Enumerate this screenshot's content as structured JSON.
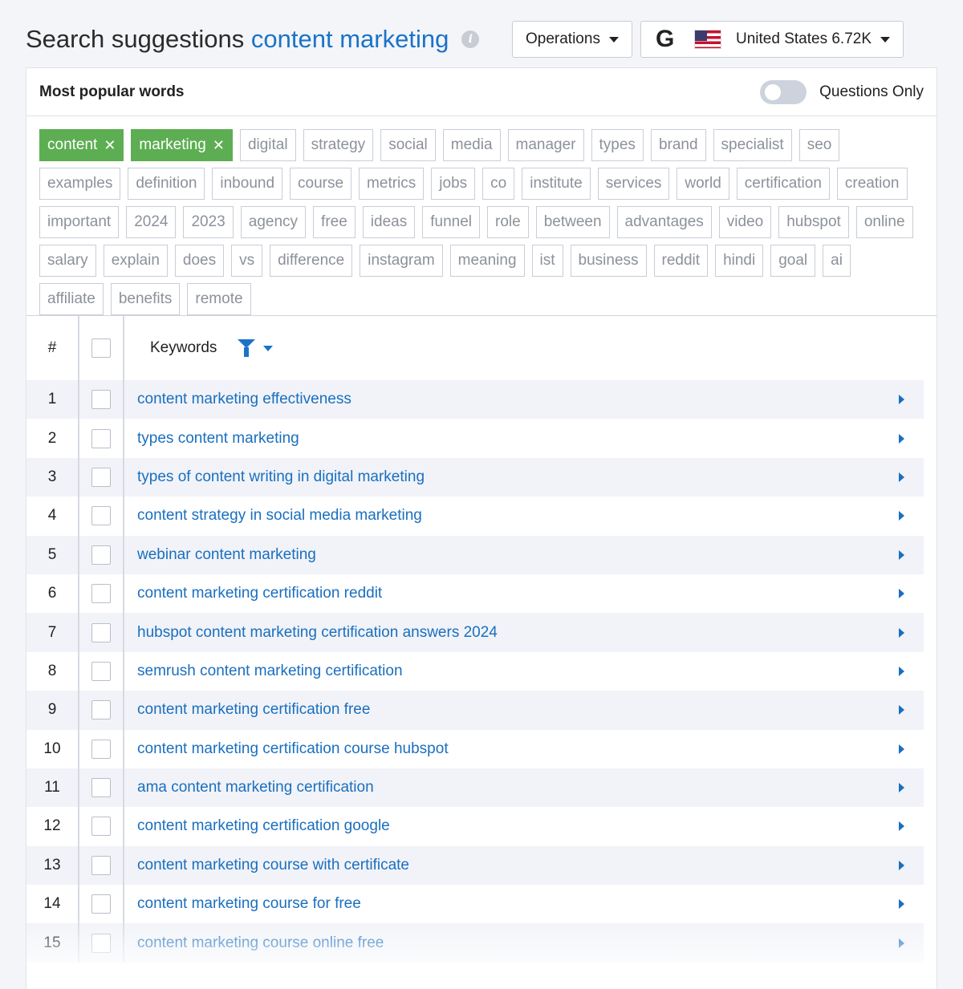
{
  "header": {
    "title_prefix": "Search suggestions",
    "title_keyword": "content marketing",
    "operations_label": "Operations",
    "region_label": "United States 6.72K",
    "search_engine": "G"
  },
  "words": {
    "title": "Most popular words",
    "questions_only_label": "Questions Only",
    "active_tags": [
      "content",
      "marketing"
    ],
    "tags": [
      "digital",
      "strategy",
      "social",
      "media",
      "manager",
      "types",
      "brand",
      "specialist",
      "seo",
      "examples",
      "definition",
      "inbound",
      "course",
      "metrics",
      "jobs",
      "co",
      "institute",
      "services",
      "world",
      "certification",
      "creation",
      "important",
      "2024",
      "2023",
      "agency",
      "free",
      "ideas",
      "funnel",
      "role",
      "between",
      "advantages",
      "video",
      "hubspot",
      "online",
      "salary",
      "explain",
      "does",
      "vs",
      "difference",
      "instagram",
      "meaning",
      "ist",
      "business",
      "reddit",
      "hindi",
      "goal",
      "ai",
      "affiliate",
      "benefits",
      "remote"
    ]
  },
  "table": {
    "col_num": "#",
    "col_keywords": "Keywords",
    "rows": [
      {
        "n": "1",
        "kw": "content marketing effectiveness"
      },
      {
        "n": "2",
        "kw": "types content marketing"
      },
      {
        "n": "3",
        "kw": "types of content writing in digital marketing"
      },
      {
        "n": "4",
        "kw": "content strategy in social media marketing"
      },
      {
        "n": "5",
        "kw": "webinar content marketing"
      },
      {
        "n": "6",
        "kw": "content marketing certification reddit"
      },
      {
        "n": "7",
        "kw": "hubspot content marketing certification answers 2024"
      },
      {
        "n": "8",
        "kw": "semrush content marketing certification"
      },
      {
        "n": "9",
        "kw": "content marketing certification free"
      },
      {
        "n": "10",
        "kw": "content marketing certification course hubspot"
      },
      {
        "n": "11",
        "kw": "ama content marketing certification"
      },
      {
        "n": "12",
        "kw": "content marketing certification google"
      },
      {
        "n": "13",
        "kw": "content marketing course with certificate"
      },
      {
        "n": "14",
        "kw": "content marketing course for free"
      },
      {
        "n": "15",
        "kw": "content marketing course online free"
      }
    ]
  }
}
